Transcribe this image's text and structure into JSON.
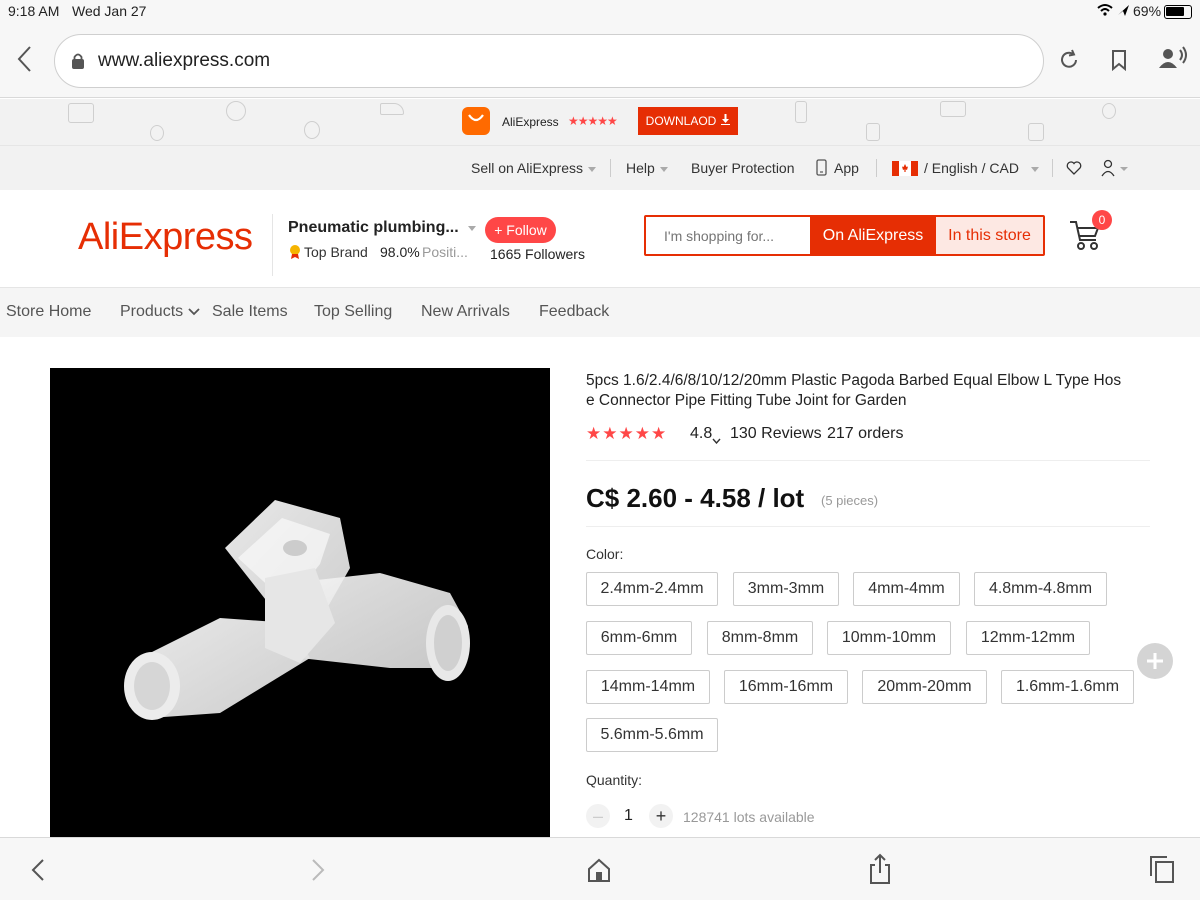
{
  "statusbar": {
    "time": "9:18 AM",
    "date": "Wed Jan 27",
    "battery": "69%"
  },
  "browser": {
    "url": "www.aliexpress.com"
  },
  "promo": {
    "app_name": "AliExpress",
    "stars": "★★★★★",
    "download_label": "DOWNLAOD"
  },
  "topnav": {
    "sell": "Sell on AliExpress",
    "help": "Help",
    "buyer_protection": "Buyer Protection",
    "app": "App",
    "lang": "/ English / CAD"
  },
  "header": {
    "logo": "AliExpress",
    "store_name": "Pneumatic plumbing...",
    "follow_label": "+ Follow",
    "top_brand": "Top Brand",
    "positive_pct": "98.0%",
    "positive_label": "Positi...",
    "followers": "1665 Followers",
    "search_placeholder": "I'm shopping for...",
    "on_aliexpress": "On AliExpress",
    "in_this_store": "In this store",
    "cart_count": "0"
  },
  "storenav": {
    "items": [
      "Store Home",
      "Products",
      "Sale Items",
      "Top Selling",
      "New Arrivals",
      "Feedback"
    ]
  },
  "product": {
    "title_line1": "5pcs 1.6/2.4/6/8/10/12/20mm Plastic Pagoda Barbed Equal Elbow L Type Hos",
    "title_line2": "e Connector Pipe Fitting Tube Joint for Garden",
    "rating": "4.8",
    "reviews": "130 Reviews",
    "orders": "217 orders",
    "price": "C$ 2.60 - 4.58 / lot",
    "pieces": "(5 pieces)",
    "color_label": "Color:",
    "colors": [
      "2.4mm-2.4mm",
      "3mm-3mm",
      "4mm-4mm",
      "4.8mm-4.8mm",
      "6mm-6mm",
      "8mm-8mm",
      "10mm-10mm",
      "12mm-12mm",
      "14mm-14mm",
      "16mm-16mm",
      "20mm-20mm",
      "1.6mm-1.6mm",
      "5.6mm-5.6mm"
    ],
    "quantity_label": "Quantity:",
    "quantity_value": "1",
    "available": "128741 lots available"
  },
  "colors": {
    "accent": "#e62e04",
    "brand_red": "#ff4747",
    "star": "#ff4747"
  }
}
